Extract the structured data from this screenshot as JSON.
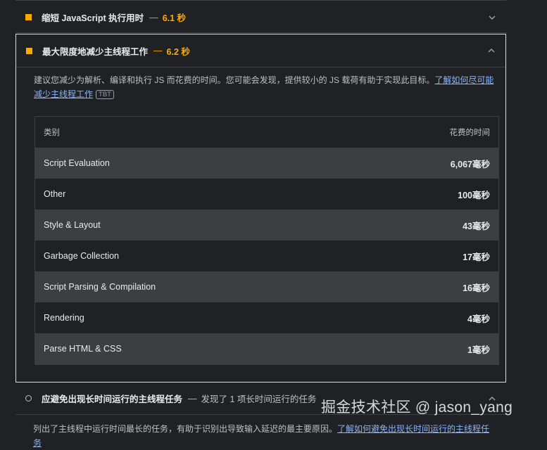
{
  "audits": [
    {
      "title": "缩短 JavaScript 执行用时",
      "separator": "—",
      "value": "6.1 秒",
      "icon": "warning-square-icon",
      "color": "#f9ab00"
    },
    {
      "title": "最大限度地减少主线程工作",
      "separator": "—",
      "value": "6.2 秒",
      "icon": "warning-square-icon",
      "color": "#f9ab00",
      "description": "建议您减少为解析、编译和执行 JS 而花费的时间。您可能会发现，提供较小的 JS 载荷有助于实现此目标。",
      "link": "了解如何尽可能减少主线程工作",
      "tag": "TBT",
      "table": {
        "headers": [
          "类别",
          "花费的时间"
        ],
        "rows": [
          {
            "category": "Script Evaluation",
            "time": "6,067毫秒"
          },
          {
            "category": "Other",
            "time": "100毫秒"
          },
          {
            "category": "Style & Layout",
            "time": "43毫秒"
          },
          {
            "category": "Garbage Collection",
            "time": "17毫秒"
          },
          {
            "category": "Script Parsing & Compilation",
            "time": "16毫秒"
          },
          {
            "category": "Rendering",
            "time": "4毫秒"
          },
          {
            "category": "Parse HTML & CSS",
            "time": "1毫秒"
          }
        ]
      }
    },
    {
      "title": "应避免出现长时间运行的主线程任务",
      "separator": "—",
      "display_text": "发现了 1 项长时间运行的任务",
      "icon": "info-circle-icon",
      "description": "列出了主线程中运行时间最长的任务，有助于识别出导致输入延迟的最主要原因。",
      "link": "了解如何避免出现长时间运行的主线程任务"
    }
  ],
  "watermark": "掘金技术社区 @ jason_yang"
}
